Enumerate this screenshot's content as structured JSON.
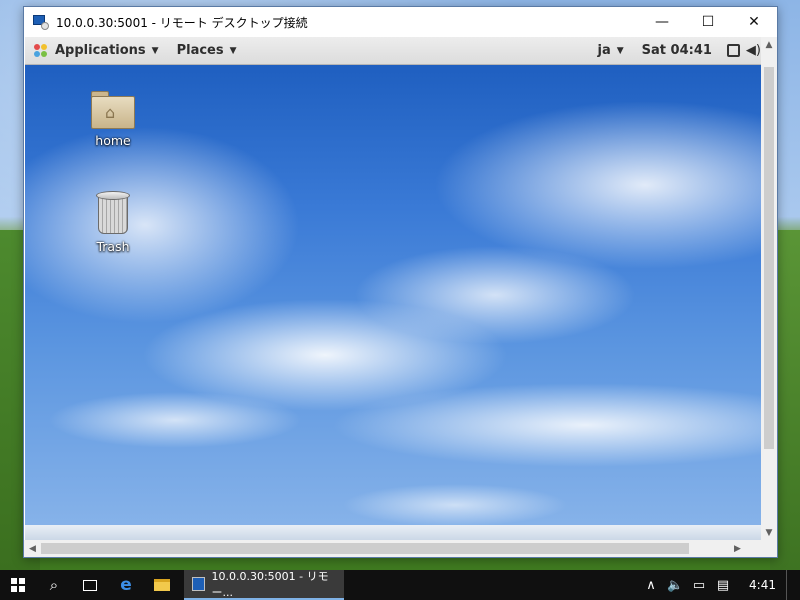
{
  "window": {
    "title": "10.0.0.30:5001 - リモート デスクトップ接続",
    "minimize": "—",
    "maximize": "☐",
    "close": "✕"
  },
  "panel": {
    "applications": "Applications",
    "places": "Places",
    "language": "ja",
    "clock": "Sat 04:41",
    "volume_icon": "speaker-icon"
  },
  "desktop_icons": [
    {
      "label": "home",
      "icon": "home-folder-icon"
    },
    {
      "label": "Trash",
      "icon": "trash-icon"
    }
  ],
  "taskbar": {
    "task_label": "10.0.0.30:5001 - リモー...",
    "clock": "4:41"
  },
  "colors": {
    "taskbar": "#101010",
    "panel": "#dcdcdc",
    "window_border": "#5a7aa5",
    "task_underline": "#7fb2e6"
  }
}
